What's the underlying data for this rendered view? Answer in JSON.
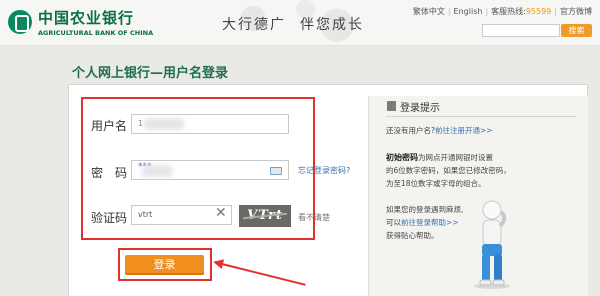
{
  "header": {
    "bank_name_cn": "中国农业银行",
    "bank_name_en": "AGRICULTURAL BANK OF CHINA",
    "slogan_left": "大行德广",
    "slogan_right": "伴您成长",
    "lang_traditional": "繁体中文",
    "lang_english": "English",
    "hotline_label": "客服热线:",
    "hotline_number": "95599",
    "weibo": "官方微博",
    "search_button": "搜索",
    "search_placeholder": ""
  },
  "page": {
    "title": "个人网上银行—用户名登录"
  },
  "form": {
    "username_label": "用户名",
    "username_value": "1",
    "password_label": "密　码",
    "password_value": "***",
    "forgot_password": "忘记登录密码?",
    "captcha_label": "验证码",
    "captcha_value": "vtrt",
    "captcha_image_text": "VTrt",
    "captcha_refresh": "看不清楚",
    "login_button": "登录"
  },
  "tips": {
    "title": "登录提示",
    "no_username": "还没有用户名?",
    "register_link": "前往注册开通>>",
    "initial_pwd_title": "初始密码",
    "initial_pwd_line1": "为网点开通网银时设置",
    "initial_pwd_line2": "的6位数字密码，如果您已修改密码，",
    "initial_pwd_line3": "为至18位数字或字母的组合。",
    "help_line1": "如果您的登录遇到麻烦,",
    "help_line2_prefix": "可以",
    "help_link": "前往登录帮助>>",
    "help_line3": "获得贴心帮助。"
  },
  "colors": {
    "brand_green": "#0a6e45",
    "accent_orange": "#f08f1e",
    "highlight_red": "#e03030"
  }
}
